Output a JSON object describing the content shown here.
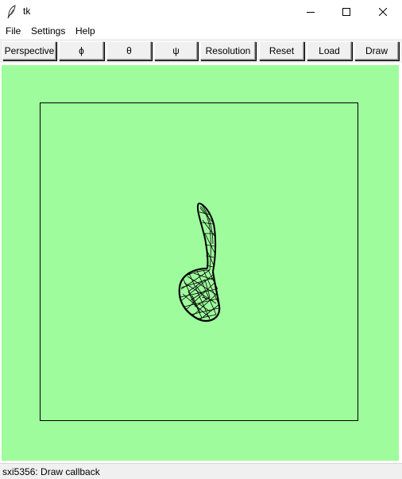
{
  "window": {
    "title": "tk",
    "app_icon": "feather-icon"
  },
  "menu": {
    "items": [
      "File",
      "Settings",
      "Help"
    ]
  },
  "toolbar": {
    "buttons": [
      "Perspective",
      "ϕ",
      "θ",
      "ψ",
      "Resolution",
      "Reset",
      "Load",
      "Draw"
    ]
  },
  "canvas": {
    "background": "#9efc9c",
    "frame_color": "#000000",
    "object": "wireframe-mesh"
  },
  "status": {
    "text": "sxi5356: Draw callback"
  }
}
